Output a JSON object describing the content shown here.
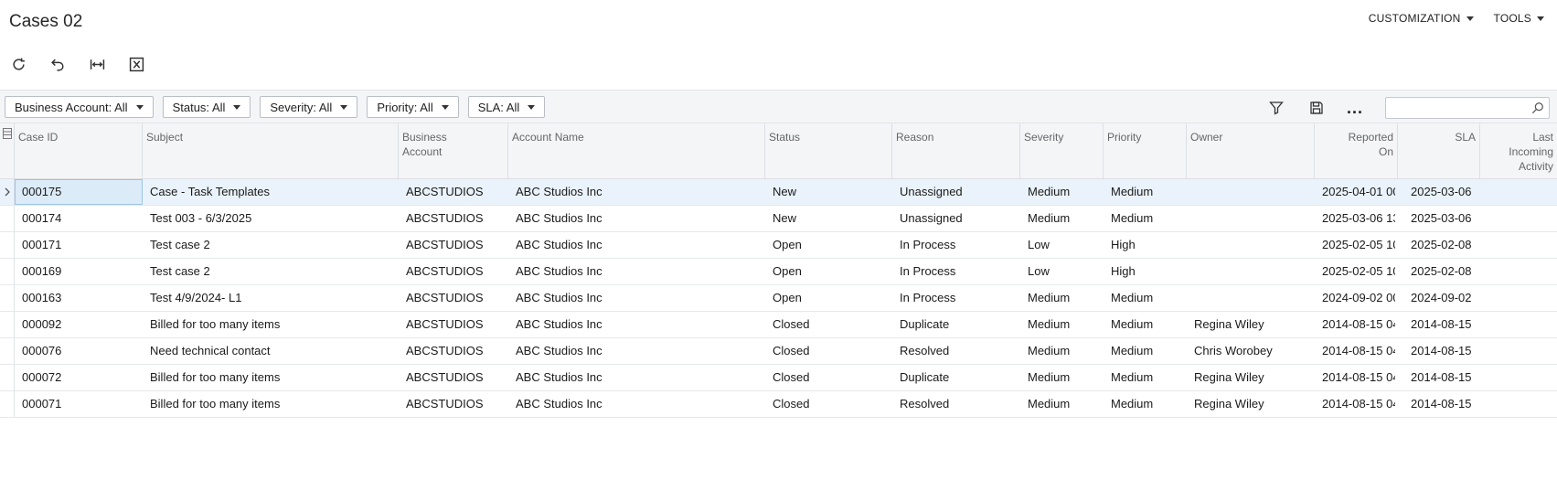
{
  "header": {
    "title": "Cases 02",
    "menu": [
      {
        "label": "CUSTOMIZATION"
      },
      {
        "label": "TOOLS"
      }
    ]
  },
  "toolbar": {
    "icons": [
      "refresh-icon",
      "undo-icon",
      "fit-columns-icon",
      "export-excel-icon"
    ]
  },
  "filters": [
    {
      "label": "Business Account: All"
    },
    {
      "label": "Status: All"
    },
    {
      "label": "Severity: All"
    },
    {
      "label": "Priority: All"
    },
    {
      "label": "SLA: All"
    }
  ],
  "grid_tools": {
    "more_label": "...",
    "search_placeholder": "",
    "search_value": ""
  },
  "grid": {
    "columns": [
      {
        "label": "Case ID"
      },
      {
        "label": "Subject"
      },
      {
        "label": "Business\nAccount"
      },
      {
        "label": "Account Name"
      },
      {
        "label": "Status"
      },
      {
        "label": "Reason"
      },
      {
        "label": "Severity"
      },
      {
        "label": "Priority"
      },
      {
        "label": "Owner"
      },
      {
        "label": "Reported\nOn"
      },
      {
        "label": "SLA"
      },
      {
        "label": "Last\nIncoming\nActivity"
      }
    ],
    "rows": [
      {
        "case_id": "000175",
        "subject": "Case - Task Templates",
        "business_account": "ABCSTUDIOS",
        "account_name": "ABC Studios Inc",
        "status": "New",
        "reason": "Unassigned",
        "severity": "Medium",
        "priority": "Medium",
        "owner": "",
        "reported_on": "2025-04-01 00",
        "sla": "2025-03-06",
        "last_activity": ""
      },
      {
        "case_id": "000174",
        "subject": "Test 003 - 6/3/2025",
        "business_account": "ABCSTUDIOS",
        "account_name": "ABC Studios Inc",
        "status": "New",
        "reason": "Unassigned",
        "severity": "Medium",
        "priority": "Medium",
        "owner": "",
        "reported_on": "2025-03-06 13",
        "sla": "2025-03-06",
        "last_activity": ""
      },
      {
        "case_id": "000171",
        "subject": "Test case 2",
        "business_account": "ABCSTUDIOS",
        "account_name": "ABC Studios Inc",
        "status": "Open",
        "reason": "In Process",
        "severity": "Low",
        "priority": "High",
        "owner": "",
        "reported_on": "2025-02-05 10",
        "sla": "2025-02-08",
        "last_activity": ""
      },
      {
        "case_id": "000169",
        "subject": "Test case 2",
        "business_account": "ABCSTUDIOS",
        "account_name": "ABC Studios Inc",
        "status": "Open",
        "reason": "In Process",
        "severity": "Low",
        "priority": "High",
        "owner": "",
        "reported_on": "2025-02-05 10",
        "sla": "2025-02-08",
        "last_activity": ""
      },
      {
        "case_id": "000163",
        "subject": "Test 4/9/2024- L1",
        "business_account": "ABCSTUDIOS",
        "account_name": "ABC Studios Inc",
        "status": "Open",
        "reason": "In Process",
        "severity": "Medium",
        "priority": "Medium",
        "owner": "",
        "reported_on": "2024-09-02 00",
        "sla": "2024-09-02",
        "last_activity": ""
      },
      {
        "case_id": "000092",
        "subject": "Billed for too many items",
        "business_account": "ABCSTUDIOS",
        "account_name": "ABC Studios Inc",
        "status": "Closed",
        "reason": "Duplicate",
        "severity": "Medium",
        "priority": "Medium",
        "owner": "Regina Wiley",
        "reported_on": "2014-08-15 04",
        "sla": "2014-08-15",
        "last_activity": ""
      },
      {
        "case_id": "000076",
        "subject": "Need technical contact",
        "business_account": "ABCSTUDIOS",
        "account_name": "ABC Studios Inc",
        "status": "Closed",
        "reason": "Resolved",
        "severity": "Medium",
        "priority": "Medium",
        "owner": "Chris Worobey",
        "reported_on": "2014-08-15 04",
        "sla": "2014-08-15",
        "last_activity": ""
      },
      {
        "case_id": "000072",
        "subject": "Billed for too many items",
        "business_account": "ABCSTUDIOS",
        "account_name": "ABC Studios Inc",
        "status": "Closed",
        "reason": "Duplicate",
        "severity": "Medium",
        "priority": "Medium",
        "owner": "Regina Wiley",
        "reported_on": "2014-08-15 04",
        "sla": "2014-08-15",
        "last_activity": ""
      },
      {
        "case_id": "000071",
        "subject": "Billed for too many items",
        "business_account": "ABCSTUDIOS",
        "account_name": "ABC Studios Inc",
        "status": "Closed",
        "reason": "Resolved",
        "severity": "Medium",
        "priority": "Medium",
        "owner": "Regina Wiley",
        "reported_on": "2014-08-15 04",
        "sla": "2014-08-15",
        "last_activity": ""
      }
    ],
    "selected_row": 0
  },
  "colors": {
    "selected_row": "#eaf3fb",
    "selected_cell": "#dcebf8",
    "header_bg": "#f4f5f7",
    "border": "#dcdfe3"
  }
}
